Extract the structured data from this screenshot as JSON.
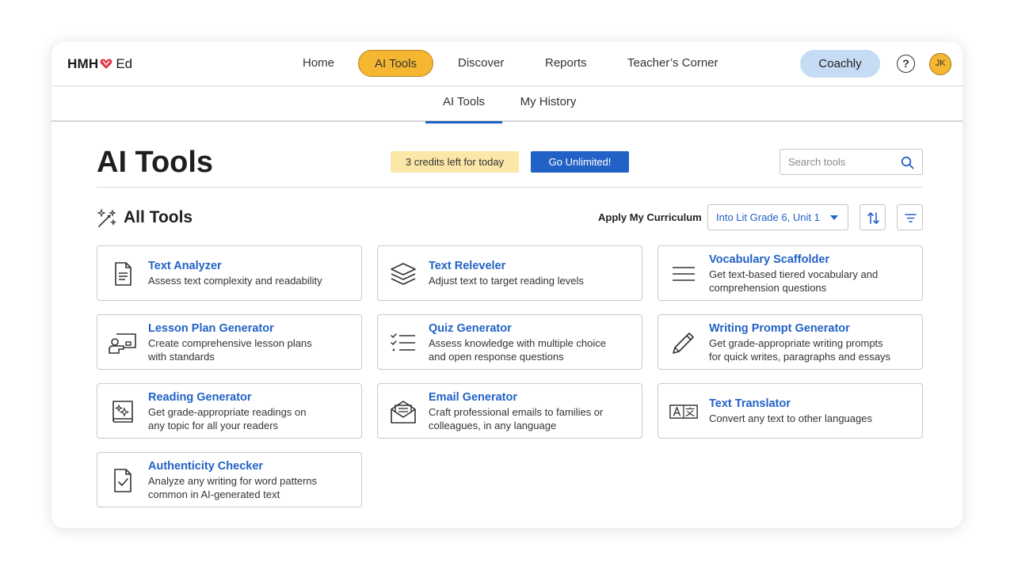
{
  "brand": {
    "logo_left": "HMH",
    "logo_right": "Ed"
  },
  "nav": {
    "items": [
      {
        "label": "Home"
      },
      {
        "label": "AI Tools"
      },
      {
        "label": "Discover"
      },
      {
        "label": "Reports"
      },
      {
        "label": "Teacher’s Corner"
      }
    ],
    "coachly": "Coachly",
    "help": "?",
    "avatar": "JK"
  },
  "subnav": {
    "tabs": [
      {
        "label": "AI Tools"
      },
      {
        "label": "My History"
      }
    ]
  },
  "header": {
    "title": "AI Tools",
    "credits": "3 credits left for today",
    "unlimited": "Go Unlimited!",
    "search_placeholder": "Search tools"
  },
  "section": {
    "title": "All Tools",
    "curriculum_label": "Apply My Curriculum",
    "curriculum_value": "Into Lit Grade 6, Unit 1"
  },
  "tools": [
    {
      "title": "Text Analyzer",
      "desc": "Assess text complexity and readability",
      "icon": "document-icon"
    },
    {
      "title": "Text Releveler",
      "desc": "Adjust text to target reading levels",
      "icon": "layers-icon"
    },
    {
      "title": "Vocabulary Scaffolder",
      "desc": "Get text-based tiered vocabulary and\ncomprehension questions",
      "icon": "lines-icon"
    },
    {
      "title": "Lesson Plan Generator",
      "desc": "Create comprehensive lesson plans\nwith standards",
      "icon": "teacher-board-icon"
    },
    {
      "title": "Quiz Generator",
      "desc": "Assess knowledge with multiple choice\n and open response questions",
      "icon": "checklist-icon"
    },
    {
      "title": "Writing Prompt Generator",
      "desc": "Get grade-appropriate writing prompts\nfor quick writes, paragraphs and essays",
      "icon": "pencil-icon"
    },
    {
      "title": "Reading Generator",
      "desc": "Get grade-appropriate readings on\nany topic for all your readers",
      "icon": "book-sparkle-icon"
    },
    {
      "title": "Email Generator",
      "desc": "Craft professional emails to families or\ncolleagues, in any language",
      "icon": "envelope-icon"
    },
    {
      "title": "Text Translator",
      "desc": "Convert any text to other languages",
      "icon": "translate-icon"
    },
    {
      "title": "Authenticity Checker",
      "desc": "Analyze any writing for word patterns\ncommon in AI-generated text",
      "icon": "document-check-icon"
    }
  ],
  "colors": {
    "accent_blue": "#2262c6",
    "active_yellow": "#f5b731",
    "credits_bg": "#fbe7a7",
    "coachly_bg": "#c6dcf5"
  }
}
